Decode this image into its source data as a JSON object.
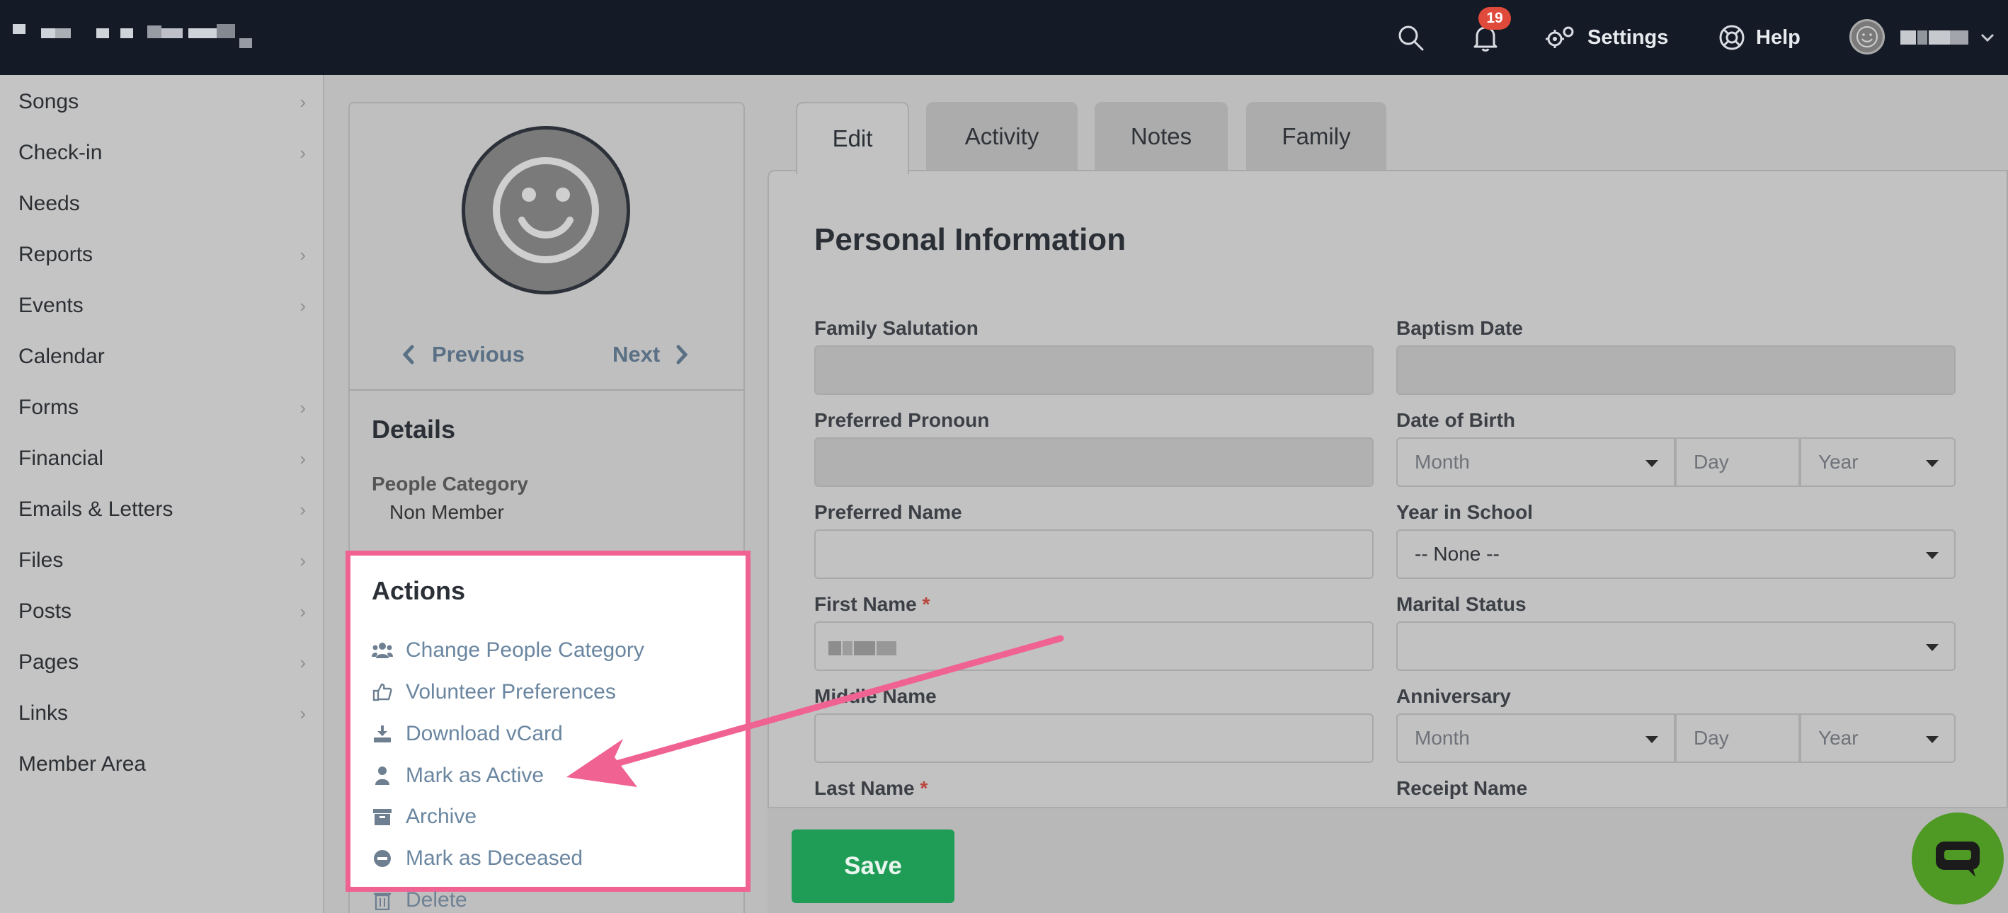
{
  "topbar": {
    "notification_count": "19",
    "settings_label": "Settings",
    "help_label": "Help"
  },
  "sidebar": {
    "items": [
      {
        "label": "Songs",
        "has_chevron": true
      },
      {
        "label": "Check-in",
        "has_chevron": true
      },
      {
        "label": "Needs",
        "has_chevron": false
      },
      {
        "label": "Reports",
        "has_chevron": true
      },
      {
        "label": "Events",
        "has_chevron": true
      },
      {
        "label": "Calendar",
        "has_chevron": false
      },
      {
        "label": "Forms",
        "has_chevron": true
      },
      {
        "label": "Financial",
        "has_chevron": true
      },
      {
        "label": "Emails & Letters",
        "has_chevron": true
      },
      {
        "label": "Files",
        "has_chevron": true
      },
      {
        "label": "Posts",
        "has_chevron": true
      },
      {
        "label": "Pages",
        "has_chevron": true
      },
      {
        "label": "Links",
        "has_chevron": true
      },
      {
        "label": "Member Area",
        "has_chevron": false
      }
    ]
  },
  "profile": {
    "previous_label": "Previous",
    "next_label": "Next",
    "details_title": "Details",
    "people_category_label": "People Category",
    "people_category_value": "Non Member",
    "actions_title": "Actions",
    "actions": [
      {
        "label": "Change People Category",
        "icon": "users-icon"
      },
      {
        "label": "Volunteer Preferences",
        "icon": "thumbs-up-icon"
      },
      {
        "label": "Download vCard",
        "icon": "download-icon"
      },
      {
        "label": "Mark as Active",
        "icon": "user-icon"
      },
      {
        "label": "Archive",
        "icon": "archive-icon"
      },
      {
        "label": "Mark as Deceased",
        "icon": "minus-circle-icon"
      },
      {
        "label": "Delete",
        "icon": "trash-icon"
      }
    ]
  },
  "tabs": [
    {
      "label": "Edit",
      "active": true
    },
    {
      "label": "Activity",
      "active": false
    },
    {
      "label": "Notes",
      "active": false
    },
    {
      "label": "Family",
      "active": false
    }
  ],
  "form": {
    "title": "Personal Information",
    "family_salutation_label": "Family Salutation",
    "baptism_date_label": "Baptism Date",
    "preferred_pronoun_label": "Preferred Pronoun",
    "date_of_birth_label": "Date of Birth",
    "preferred_name_label": "Preferred Name",
    "year_in_school_label": "Year in School",
    "year_in_school_value": "-- None --",
    "first_name_label": "First Name",
    "marital_status_label": "Marital Status",
    "middle_name_label": "Middle Name",
    "anniversary_label": "Anniversary",
    "last_name_label": "Last Name",
    "receipt_name_label": "Receipt Name",
    "required_marker": "*",
    "month_placeholder": "Month",
    "day_placeholder": "Day",
    "year_placeholder": "Year"
  },
  "save_label": "Save",
  "colors": {
    "topbar": "#151b26",
    "highlight": "#f06292",
    "save": "#1f9d57",
    "chat": "#4e9a24",
    "link": "#6a86a0"
  }
}
